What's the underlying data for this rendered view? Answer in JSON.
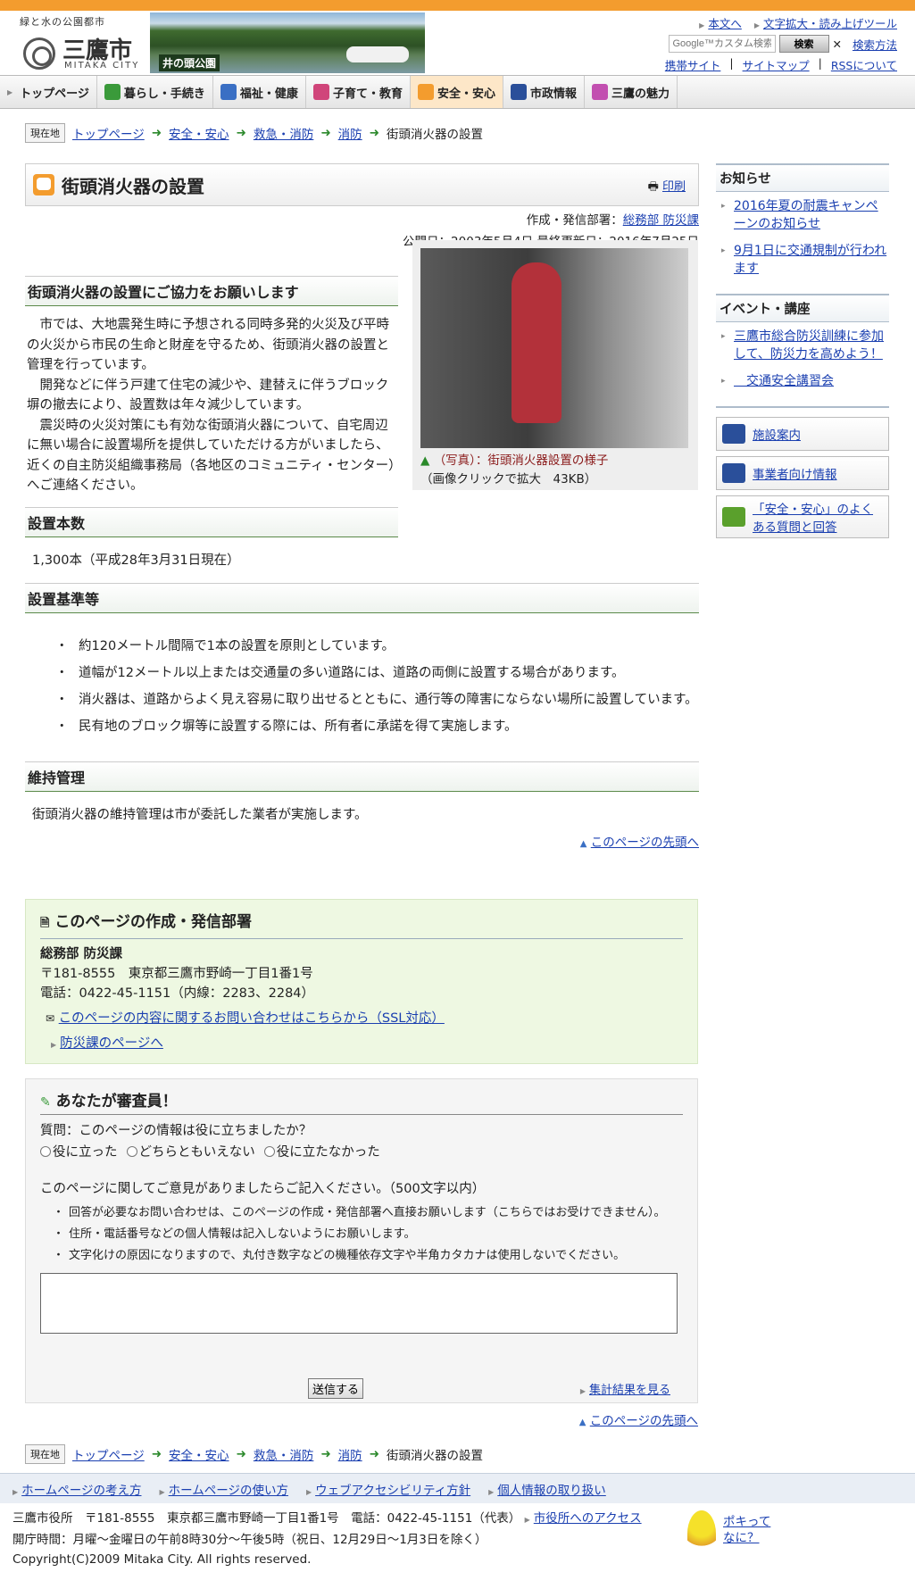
{
  "header": {
    "tagline": "緑と水の公園都市",
    "city_name": "三鷹市",
    "city_en": "MITAKA CITY",
    "photo_caption": "井の頭公園",
    "util_links": [
      "本文へ",
      "文字拡大・読み上げツール"
    ],
    "search_placeholder": "Google™カスタム検索",
    "search_button": "検索",
    "clear": "✕",
    "search_help": "検索方法",
    "sub_links": [
      "携帯サイト",
      "サイトマップ",
      "RSSについて"
    ],
    "separator": "|"
  },
  "nav": {
    "items": [
      {
        "label": "トップページ",
        "color": "#ffffff"
      },
      {
        "label": "暮らし・手続き",
        "color": "#3a9a3a"
      },
      {
        "label": "福祉・健康",
        "color": "#3a6fc4"
      },
      {
        "label": "子育て・教育",
        "color": "#d0457a"
      },
      {
        "label": "安全・安心",
        "color": "#f39c2e"
      },
      {
        "label": "市政情報",
        "color": "#2a4f9a"
      },
      {
        "label": "三鷹の魅力",
        "color": "#c24fb0"
      }
    ]
  },
  "breadcrumb": {
    "here": "現在地",
    "items": [
      "トップページ",
      "安全・安心",
      "救急・消防",
      "消防"
    ],
    "current": "街頭消火器の設置",
    "arrow": "➜"
  },
  "page": {
    "title": "街頭消火器の設置",
    "print": "印刷",
    "author_label": "作成・発信部署：",
    "author": "総務部 防災課",
    "dates": "公開日：2003年5月4日 最終更新日：2016年7月25日"
  },
  "content": {
    "h_request": "街頭消火器の設置にご協力をお願いします",
    "paras": [
      "市では、大地震発生時に予想される同時多発的火災及び平時の火災から市民の生命と財産を守るため、街頭消火器の設置と管理を行っています。",
      "開発などに伴う戸建て住宅の減少や、建替えに伴うブロック塀の撤去により、設置数は年々減少しています。",
      "震災時の火災対策にも有効な街頭消火器について、自宅周辺に無い場合に設置場所を提供していただける方がいましたら、近くの自主防災組織事務局（各地区のコミュニティ・センター）へご連絡ください。"
    ],
    "fig_caption1": "（写真）：街頭消火器設置の様子",
    "fig_caption2": "（画像クリックで拡大　43KB）",
    "fig_mark": "▲",
    "h_count": "設置本数",
    "count": "1,300本（平成28年3月31日現在）",
    "h_criteria": "設置基準等",
    "criteria": [
      "約120メートル間隔で1本の設置を原則としています。",
      "道幅が12メートル以上または交通量の多い道路には、道路の両側に設置する場合があります。",
      "消火器は、道路からよく見え容易に取り出せるとともに、通行等の障害にならない場所に設置しています。",
      "民有地のブロック塀等に設置する際には、所有者に承諾を得て実施します。"
    ],
    "h_maint": "維持管理",
    "maint": "街頭消火器の維持管理は市が委託した業者が実施します。",
    "totop": "このページの先頭へ",
    "totop_mark": "▲"
  },
  "dept": {
    "heading": "このページの作成・発信部署",
    "name": "総務部 防災課",
    "address": "〒181-8555　東京都三鷹市野崎一丁目1番1号",
    "tel": "電話：0422-45-1151（内線：2283、2284）",
    "inquiry": "このページの内容に関するお問い合わせはこちらから（SSL対応）",
    "dept_page": "防災課のページへ"
  },
  "vote": {
    "heading": "あなたが審査員！",
    "question": "質問：このページの情報は役に立ちましたか？",
    "options": [
      "役に立った",
      "どちらともいえない",
      "役に立たなかった"
    ],
    "comment_prompt": "このページに関してご意見がありましたらご記入ください。（500文字以内）",
    "notes": [
      "回答が必要なお問い合わせは、このページの作成・発信部署へ直接お願いします（こちらではお受けできません）。",
      "住所・電話番号などの個人情報は記入しないようにお願いします。",
      "文字化けの原因になりますので、丸付き数字などの機種依存文字や半角カタカナは使用しないでください。"
    ],
    "send": "送信する",
    "results": "集計結果を見る"
  },
  "side": {
    "news_heading": "お知らせ",
    "news": [
      "2016年夏の耐震キャンペーンのお知らせ",
      "9月1日に交通規制が行われます"
    ],
    "events_heading": "イベント・講座",
    "events": [
      "三鷹市総合防災訓練に参加して、防災力を高めよう！",
      "　交通安全講習会"
    ],
    "buttons": [
      {
        "label": "施設案内",
        "color": "#2a4f9a"
      },
      {
        "label": "事業者向け情報",
        "color": "#2a4f9a"
      },
      {
        "label": "「安全・安心」のよくある質問と回答",
        "color": "#5aa02c"
      }
    ]
  },
  "footer": {
    "links": [
      "ホームページの考え方",
      "ホームページの使い方",
      "ウェブアクセシビリティ方針",
      "個人情報の取り扱い"
    ],
    "office": "三鷹市役所　〒181-8555　東京都三鷹市野崎一丁目1番1号　電話：0422-45-1151（代表）",
    "access": "市役所へのアクセス",
    "hours": "開庁時間：月曜～金曜日の午前8時30分～午後5時（祝日、12月29日～1月3日を除く）",
    "copyright": "Copyright(C)2009 Mitaka City. All rights reserved.",
    "poki_line1": "ポキって",
    "poki_line2": "なに？"
  }
}
